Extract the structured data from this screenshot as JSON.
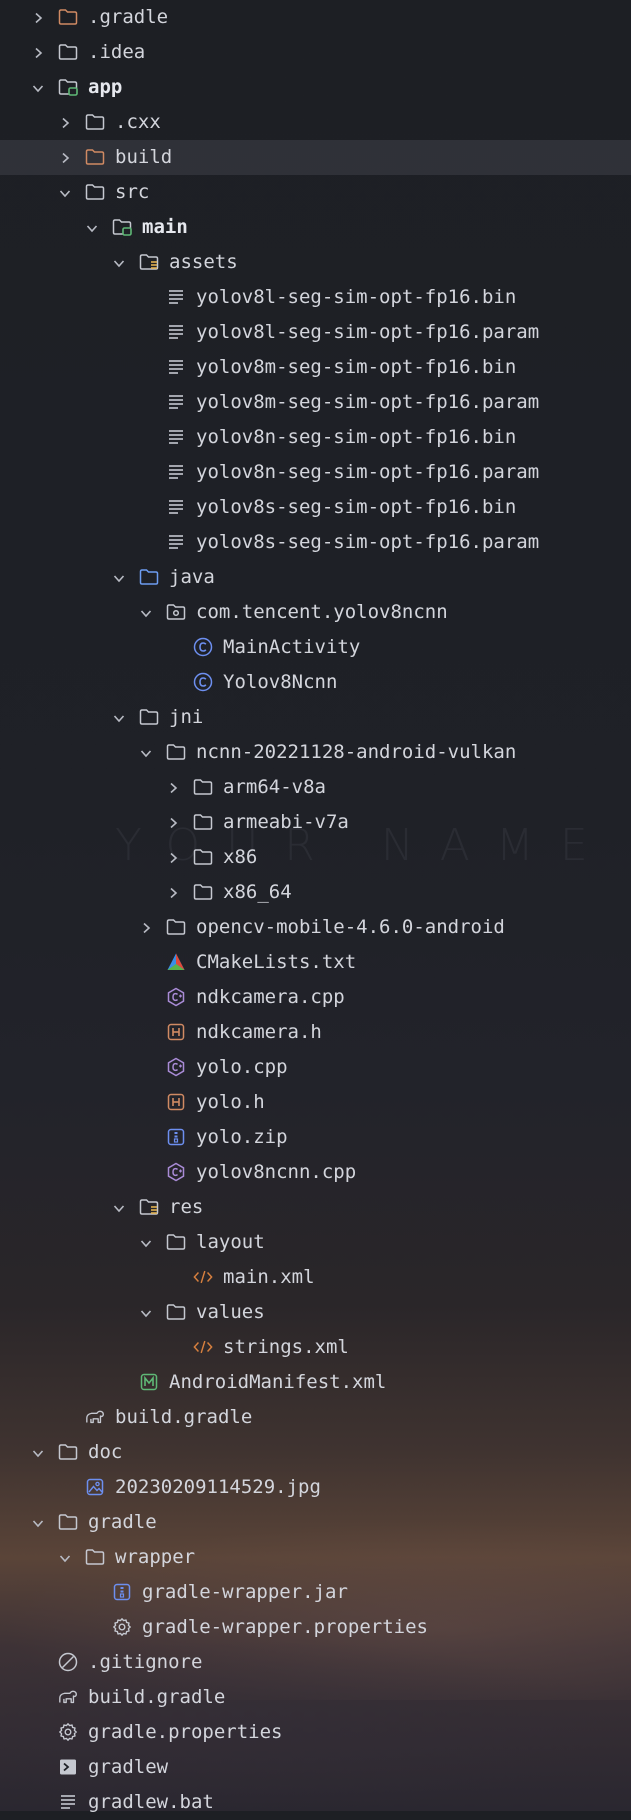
{
  "watermark": "YOUR NAME",
  "colors": {
    "text": "#d3d5dc",
    "folder": "#c5c8d0",
    "folder_orange": "#d08a63",
    "folder_blue": "#6d9cf0",
    "module_badge": "#5fb876",
    "class_icon": "#6d8ff0",
    "cpp_icon": "#a98bd6",
    "header_icon": "#d08a63",
    "xml_icon": "#d8803f",
    "manifest_icon": "#5fb876"
  },
  "tree": {
    "items": [
      {
        "label": ".gradle",
        "depth": 1,
        "arrow": "right",
        "icon": "folder-orange"
      },
      {
        "label": ".idea",
        "depth": 1,
        "arrow": "right",
        "icon": "folder"
      },
      {
        "label": "app",
        "depth": 1,
        "arrow": "down",
        "icon": "module-folder",
        "bold": true
      },
      {
        "label": ".cxx",
        "depth": 2,
        "arrow": "right",
        "icon": "folder"
      },
      {
        "label": "build",
        "depth": 2,
        "arrow": "right",
        "icon": "folder-orange",
        "highlight": true
      },
      {
        "label": "src",
        "depth": 2,
        "arrow": "down",
        "icon": "folder"
      },
      {
        "label": "main",
        "depth": 3,
        "arrow": "down",
        "icon": "module-folder",
        "bold": true
      },
      {
        "label": "assets",
        "depth": 4,
        "arrow": "down",
        "icon": "resource-folder"
      },
      {
        "label": "yolov8l-seg-sim-opt-fp16.bin",
        "depth": 5,
        "arrow": "none",
        "icon": "text-file"
      },
      {
        "label": "yolov8l-seg-sim-opt-fp16.param",
        "depth": 5,
        "arrow": "none",
        "icon": "text-file"
      },
      {
        "label": "yolov8m-seg-sim-opt-fp16.bin",
        "depth": 5,
        "arrow": "none",
        "icon": "text-file"
      },
      {
        "label": "yolov8m-seg-sim-opt-fp16.param",
        "depth": 5,
        "arrow": "none",
        "icon": "text-file"
      },
      {
        "label": "yolov8n-seg-sim-opt-fp16.bin",
        "depth": 5,
        "arrow": "none",
        "icon": "text-file"
      },
      {
        "label": "yolov8n-seg-sim-opt-fp16.param",
        "depth": 5,
        "arrow": "none",
        "icon": "text-file"
      },
      {
        "label": "yolov8s-seg-sim-opt-fp16.bin",
        "depth": 5,
        "arrow": "none",
        "icon": "text-file"
      },
      {
        "label": "yolov8s-seg-sim-opt-fp16.param",
        "depth": 5,
        "arrow": "none",
        "icon": "text-file"
      },
      {
        "label": "java",
        "depth": 4,
        "arrow": "down",
        "icon": "folder-blue"
      },
      {
        "label": "com.tencent.yolov8ncnn",
        "depth": 5,
        "arrow": "down",
        "icon": "package"
      },
      {
        "label": "MainActivity",
        "depth": 6,
        "arrow": "none",
        "icon": "class"
      },
      {
        "label": "Yolov8Ncnn",
        "depth": 6,
        "arrow": "none",
        "icon": "class"
      },
      {
        "label": "jni",
        "depth": 4,
        "arrow": "down",
        "icon": "folder"
      },
      {
        "label": "ncnn-20221128-android-vulkan",
        "depth": 5,
        "arrow": "down",
        "icon": "folder"
      },
      {
        "label": "arm64-v8a",
        "depth": 6,
        "arrow": "right",
        "icon": "folder"
      },
      {
        "label": "armeabi-v7a",
        "depth": 6,
        "arrow": "right",
        "icon": "folder"
      },
      {
        "label": "x86",
        "depth": 6,
        "arrow": "right",
        "icon": "folder"
      },
      {
        "label": "x86_64",
        "depth": 6,
        "arrow": "right",
        "icon": "folder"
      },
      {
        "label": "opencv-mobile-4.6.0-android",
        "depth": 5,
        "arrow": "right",
        "icon": "folder"
      },
      {
        "label": "CMakeLists.txt",
        "depth": 5,
        "arrow": "none",
        "icon": "cmake"
      },
      {
        "label": "ndkcamera.cpp",
        "depth": 5,
        "arrow": "none",
        "icon": "cpp"
      },
      {
        "label": "ndkcamera.h",
        "depth": 5,
        "arrow": "none",
        "icon": "header"
      },
      {
        "label": "yolo.cpp",
        "depth": 5,
        "arrow": "none",
        "icon": "cpp"
      },
      {
        "label": "yolo.h",
        "depth": 5,
        "arrow": "none",
        "icon": "header"
      },
      {
        "label": "yolo.zip",
        "depth": 5,
        "arrow": "none",
        "icon": "archive"
      },
      {
        "label": "yolov8ncnn.cpp",
        "depth": 5,
        "arrow": "none",
        "icon": "cpp"
      },
      {
        "label": "res",
        "depth": 4,
        "arrow": "down",
        "icon": "resource-folder"
      },
      {
        "label": "layout",
        "depth": 5,
        "arrow": "down",
        "icon": "folder"
      },
      {
        "label": "main.xml",
        "depth": 6,
        "arrow": "none",
        "icon": "xml"
      },
      {
        "label": "values",
        "depth": 5,
        "arrow": "down",
        "icon": "folder"
      },
      {
        "label": "strings.xml",
        "depth": 6,
        "arrow": "none",
        "icon": "xml"
      },
      {
        "label": "AndroidManifest.xml",
        "depth": 4,
        "arrow": "none",
        "icon": "manifest"
      },
      {
        "label": "build.gradle",
        "depth": 2,
        "arrow": "none",
        "icon": "gradle"
      },
      {
        "label": "doc",
        "depth": 1,
        "arrow": "down",
        "icon": "folder"
      },
      {
        "label": "20230209114529.jpg",
        "depth": 2,
        "arrow": "none",
        "icon": "image"
      },
      {
        "label": "gradle",
        "depth": 1,
        "arrow": "down",
        "icon": "folder"
      },
      {
        "label": "wrapper",
        "depth": 2,
        "arrow": "down",
        "icon": "folder"
      },
      {
        "label": "gradle-wrapper.jar",
        "depth": 3,
        "arrow": "none",
        "icon": "archive"
      },
      {
        "label": "gradle-wrapper.properties",
        "depth": 3,
        "arrow": "none",
        "icon": "gear"
      },
      {
        "label": ".gitignore",
        "depth": 1,
        "arrow": "none",
        "icon": "ignore"
      },
      {
        "label": "build.gradle",
        "depth": 1,
        "arrow": "none",
        "icon": "gradle"
      },
      {
        "label": "gradle.properties",
        "depth": 1,
        "arrow": "none",
        "icon": "gear"
      },
      {
        "label": "gradlew",
        "depth": 1,
        "arrow": "none",
        "icon": "terminal"
      },
      {
        "label": "gradlew.bat",
        "depth": 1,
        "arrow": "none",
        "icon": "text-file"
      }
    ]
  }
}
